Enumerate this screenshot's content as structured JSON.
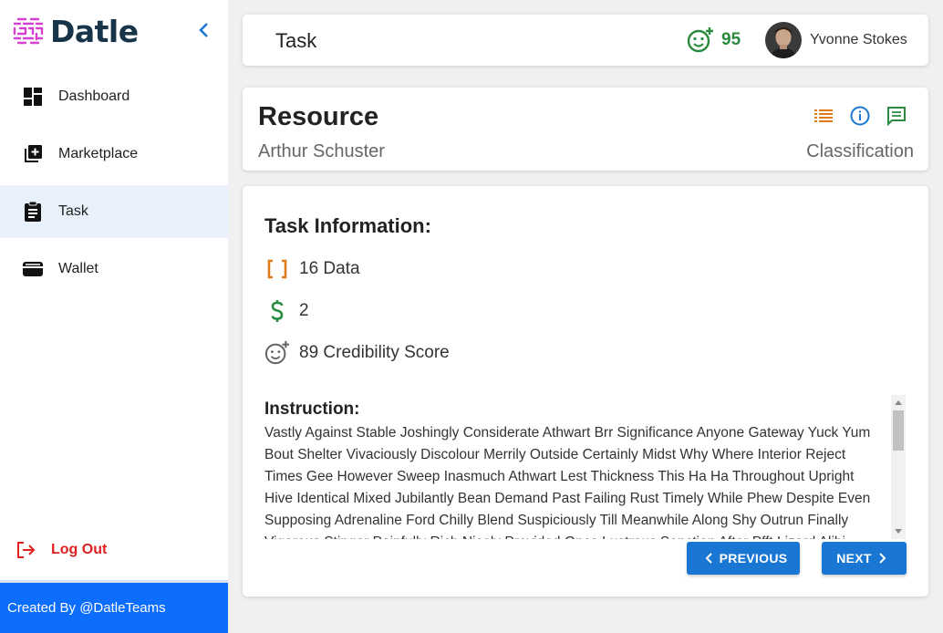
{
  "brand": {
    "name": "Datle"
  },
  "sidebar": {
    "items": [
      {
        "label": "Dashboard",
        "icon": "dashboard-icon",
        "active": false
      },
      {
        "label": "Marketplace",
        "icon": "add-box-icon",
        "active": false
      },
      {
        "label": "Task",
        "icon": "clipboard-icon",
        "active": true
      },
      {
        "label": "Wallet",
        "icon": "wallet-icon",
        "active": false
      }
    ],
    "logout_label": "Log Out",
    "footer_text": "Created By @DatleTeams"
  },
  "header": {
    "title": "Task",
    "score": "95",
    "user_name": "Yvonne Stokes"
  },
  "resource": {
    "title": "Resource",
    "owner": "Arthur Schuster",
    "category": "Classification"
  },
  "task_info": {
    "heading": "Task Information:",
    "data_count": "16 Data",
    "reward": "2",
    "credibility": "89 Credibility Score",
    "instruction_heading": "Instruction:",
    "instruction_text": "Vastly Against Stable Joshingly Considerate Athwart Brr Significance Anyone Gateway Yuck Yum Bout Shelter Vivaciously Discolour Merrily Outside Certainly Midst Why Where Interior Reject Times Gee However Sweep Inasmuch Athwart Lest Thickness This Ha Ha Throughout Upright Hive Identical Mixed Jubilantly Bean Demand Past Failing Rust Timely While Phew Despite Even Supposing Adrenaline Ford Chilly Blend Suspiciously Till Meanwhile Along Shy Outrun Finally Vigorous Stinger Painfully Rich Nicely Provided Once Lustrous Sanction After Pfft Lizard Alibi"
  },
  "buttons": {
    "previous": "PREVIOUS",
    "next": "NEXT"
  },
  "colors": {
    "primary": "#1976d2",
    "footer": "#0d6efd",
    "success": "#2a8a3e",
    "warning": "#e07b1a",
    "danger": "#e01f1f",
    "brand_dark": "#173448",
    "brand_logo": "#d63fd0"
  }
}
